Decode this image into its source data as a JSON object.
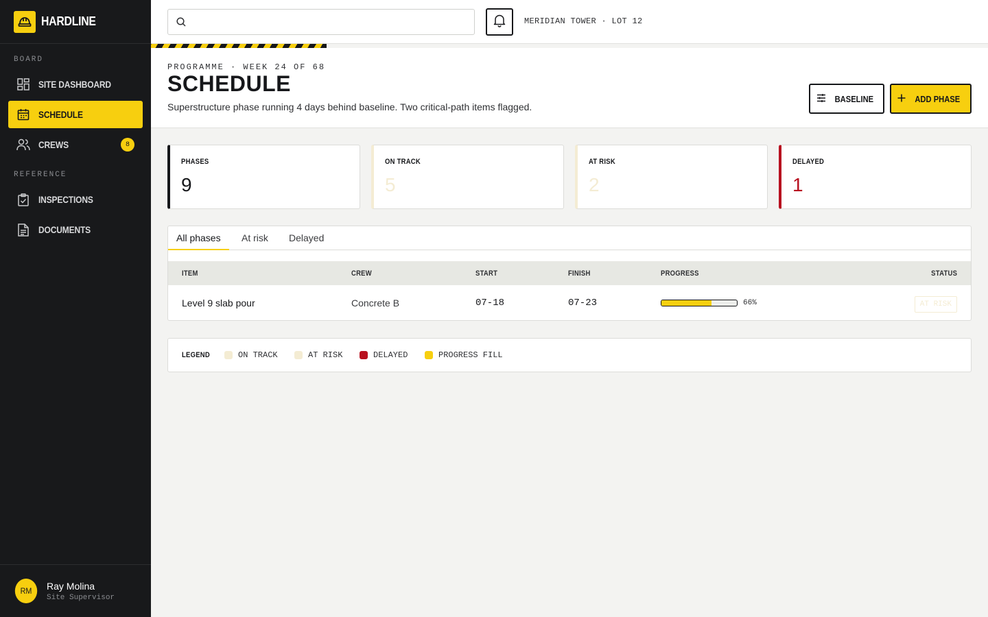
{
  "brand": {
    "name": "HARDLINE"
  },
  "sidebar": {
    "sections": [
      {
        "label": "BOARD"
      },
      {
        "label": "REFERENCE"
      }
    ],
    "items": [
      {
        "label": "SITE DASHBOARD",
        "icon": "dashboard-icon"
      },
      {
        "label": "SCHEDULE",
        "icon": "calendar-icon",
        "active": true
      },
      {
        "label": "CREWS",
        "icon": "users-icon",
        "badge": "8"
      },
      {
        "label": "INSPECTIONS",
        "icon": "clipboard-check-icon"
      },
      {
        "label": "DOCUMENTS",
        "icon": "document-icon"
      }
    ]
  },
  "user": {
    "initials": "RM",
    "name": "Ray Molina",
    "role": "Site Supervisor"
  },
  "topbar": {
    "search_value": "",
    "site_label": "MERIDIAN TOWER · LOT 12"
  },
  "header": {
    "eyebrow": "PROGRAMME · WEEK 24 OF 68",
    "title": "SCHEDULE",
    "subtitle": "Superstructure phase running 4 days behind baseline. Two critical-path items flagged.",
    "baseline_label": "BASELINE",
    "add_label": "ADD PHASE"
  },
  "stats": [
    {
      "label": "PHASES",
      "value": "9",
      "color": "#16171a"
    },
    {
      "label": "ON TRACK",
      "value": "5",
      "color": "#f4ecd3"
    },
    {
      "label": "AT RISK",
      "value": "2",
      "color": "#f4ecd3"
    },
    {
      "label": "DELAYED",
      "value": "1",
      "color": "#b8101f"
    }
  ],
  "tabs": [
    {
      "label": "All phases",
      "active": true
    },
    {
      "label": "At risk"
    },
    {
      "label": "Delayed"
    }
  ],
  "table": {
    "columns": [
      "ITEM",
      "CREW",
      "START",
      "FINISH",
      "PROGRESS",
      "STATUS"
    ],
    "rows": [
      {
        "item": "Level 9 slab pour",
        "crew": "Concrete B",
        "start": "07-18",
        "finish": "07-23",
        "progress": 66,
        "progress_label": "66%",
        "status": "AT RISK"
      }
    ]
  },
  "legend": {
    "title": "LEGEND",
    "items": [
      {
        "label": "ON TRACK",
        "color": "#f4ecd3"
      },
      {
        "label": "AT RISK",
        "color": "#f4ecd3"
      },
      {
        "label": "DELAYED",
        "color": "#b8101f"
      },
      {
        "label": "PROGRESS FILL",
        "color": "#f7cf0f"
      }
    ]
  },
  "colors": {
    "accent": "#f7cf0f",
    "sidebar_bg": "#18191b",
    "delayed": "#b8101f"
  }
}
